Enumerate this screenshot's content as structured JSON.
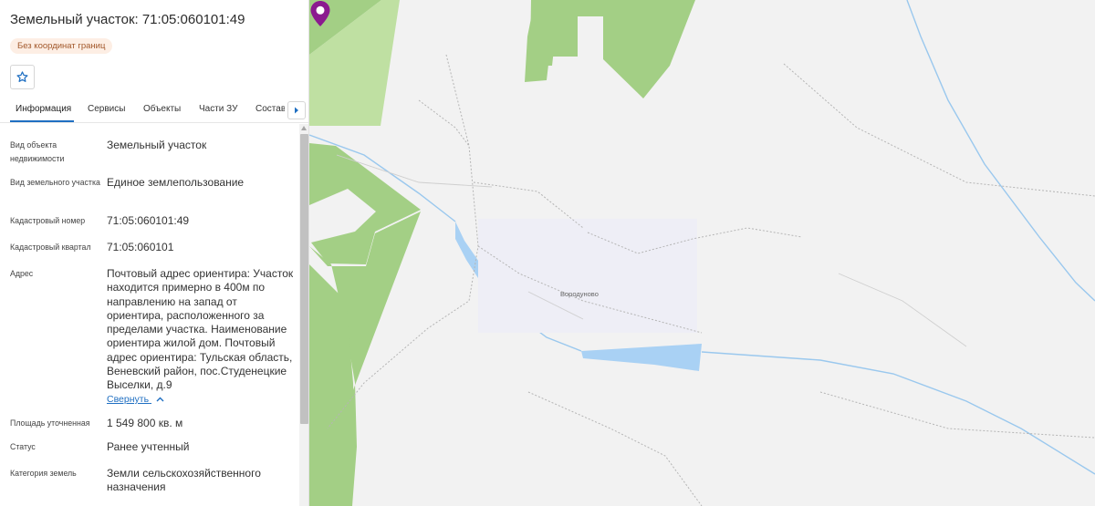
{
  "object": {
    "title": "Земельный участок: 71:05:060101:49",
    "badge": "Без координат границ"
  },
  "tabs": [
    {
      "label": "Информация",
      "active": true
    },
    {
      "label": "Сервисы"
    },
    {
      "label": "Объекты"
    },
    {
      "label": "Части ЗУ"
    },
    {
      "label": "Состав"
    }
  ],
  "fields": {
    "type": {
      "label": "Вид объекта недвижимости",
      "value": "Земельный участок"
    },
    "land_type": {
      "label": "Вид земельного участка",
      "value": "Единое землепользование"
    },
    "cadastral_number": {
      "label": "Кадастровый номер",
      "value": "71:05:060101:49"
    },
    "cadastral_quarter": {
      "label": "Кадастровый квартал",
      "value": "71:05:060101"
    },
    "address": {
      "label": "Адрес",
      "value": "Почтовый адрес ориентира: Участок находится примерно в 400м по направлению на запад от ориентира, расположенного за пределами участка. Наименование ориентира жилой дом. Почтовый адрес ориентира: Тульская область, Веневский район, пос.Студенецкие Выселки, д.9",
      "collapse_label": "Свернуть"
    },
    "area": {
      "label": "Площадь уточненная",
      "value": "1 549 800 кв. м"
    },
    "status": {
      "label": "Статус",
      "value": "Ранее учтенный"
    },
    "category": {
      "label": "Категория земель",
      "value": "Земли сельскохозяйственного назначения"
    }
  },
  "map": {
    "village_label": "Вородуново",
    "colors": {
      "background": "#f2f2f2",
      "forest": "#a3cf85",
      "meadow": "#bfe0a2",
      "water": "#a9d1f4",
      "river": "#9ac8ee",
      "pin": "#8b1a8f",
      "accent": "#1f6fc2"
    }
  },
  "icons": {
    "favorite": "star-outline-icon",
    "tabs_next": "caret-right-icon",
    "collapse": "chevron-up-icon",
    "marker": "map-pin-icon"
  }
}
